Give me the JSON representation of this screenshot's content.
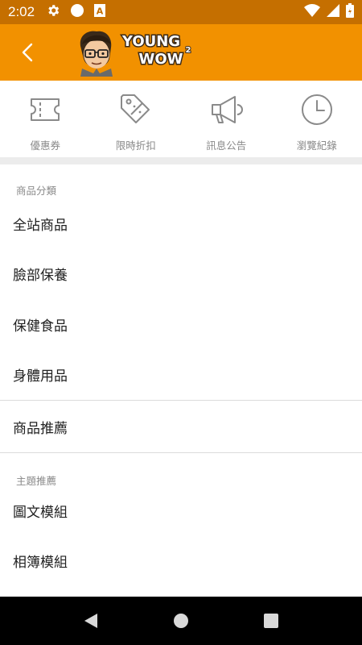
{
  "status_bar": {
    "time": "2:02",
    "icons": [
      "gear-icon",
      "circle-icon",
      "font-icon",
      "wifi-icon",
      "signal-icon",
      "battery-icon"
    ]
  },
  "app_bar": {
    "logo_line1": "YOUNG",
    "logo_line2": "WOW",
    "logo_sup": "2",
    "accent": "#f29100",
    "status_color": "#c56f00"
  },
  "quick_actions": [
    {
      "label": "優惠券",
      "icon": "ticket-icon"
    },
    {
      "label": "限時折扣",
      "icon": "discount-tag-icon"
    },
    {
      "label": "訊息公告",
      "icon": "megaphone-icon"
    },
    {
      "label": "瀏覽紀錄",
      "icon": "clock-icon"
    }
  ],
  "menu": {
    "section1_title": "商品分類",
    "section1_items": [
      "全站商品",
      "臉部保養",
      "保健食品",
      "身體用品"
    ],
    "recommend_item": "商品推薦",
    "section2_title": "主題推薦",
    "section2_items": [
      "圖文模組",
      "相簿模組"
    ]
  },
  "nav_bar": {
    "buttons": [
      "back-triangle-icon",
      "home-circle-icon",
      "recents-square-icon"
    ]
  }
}
